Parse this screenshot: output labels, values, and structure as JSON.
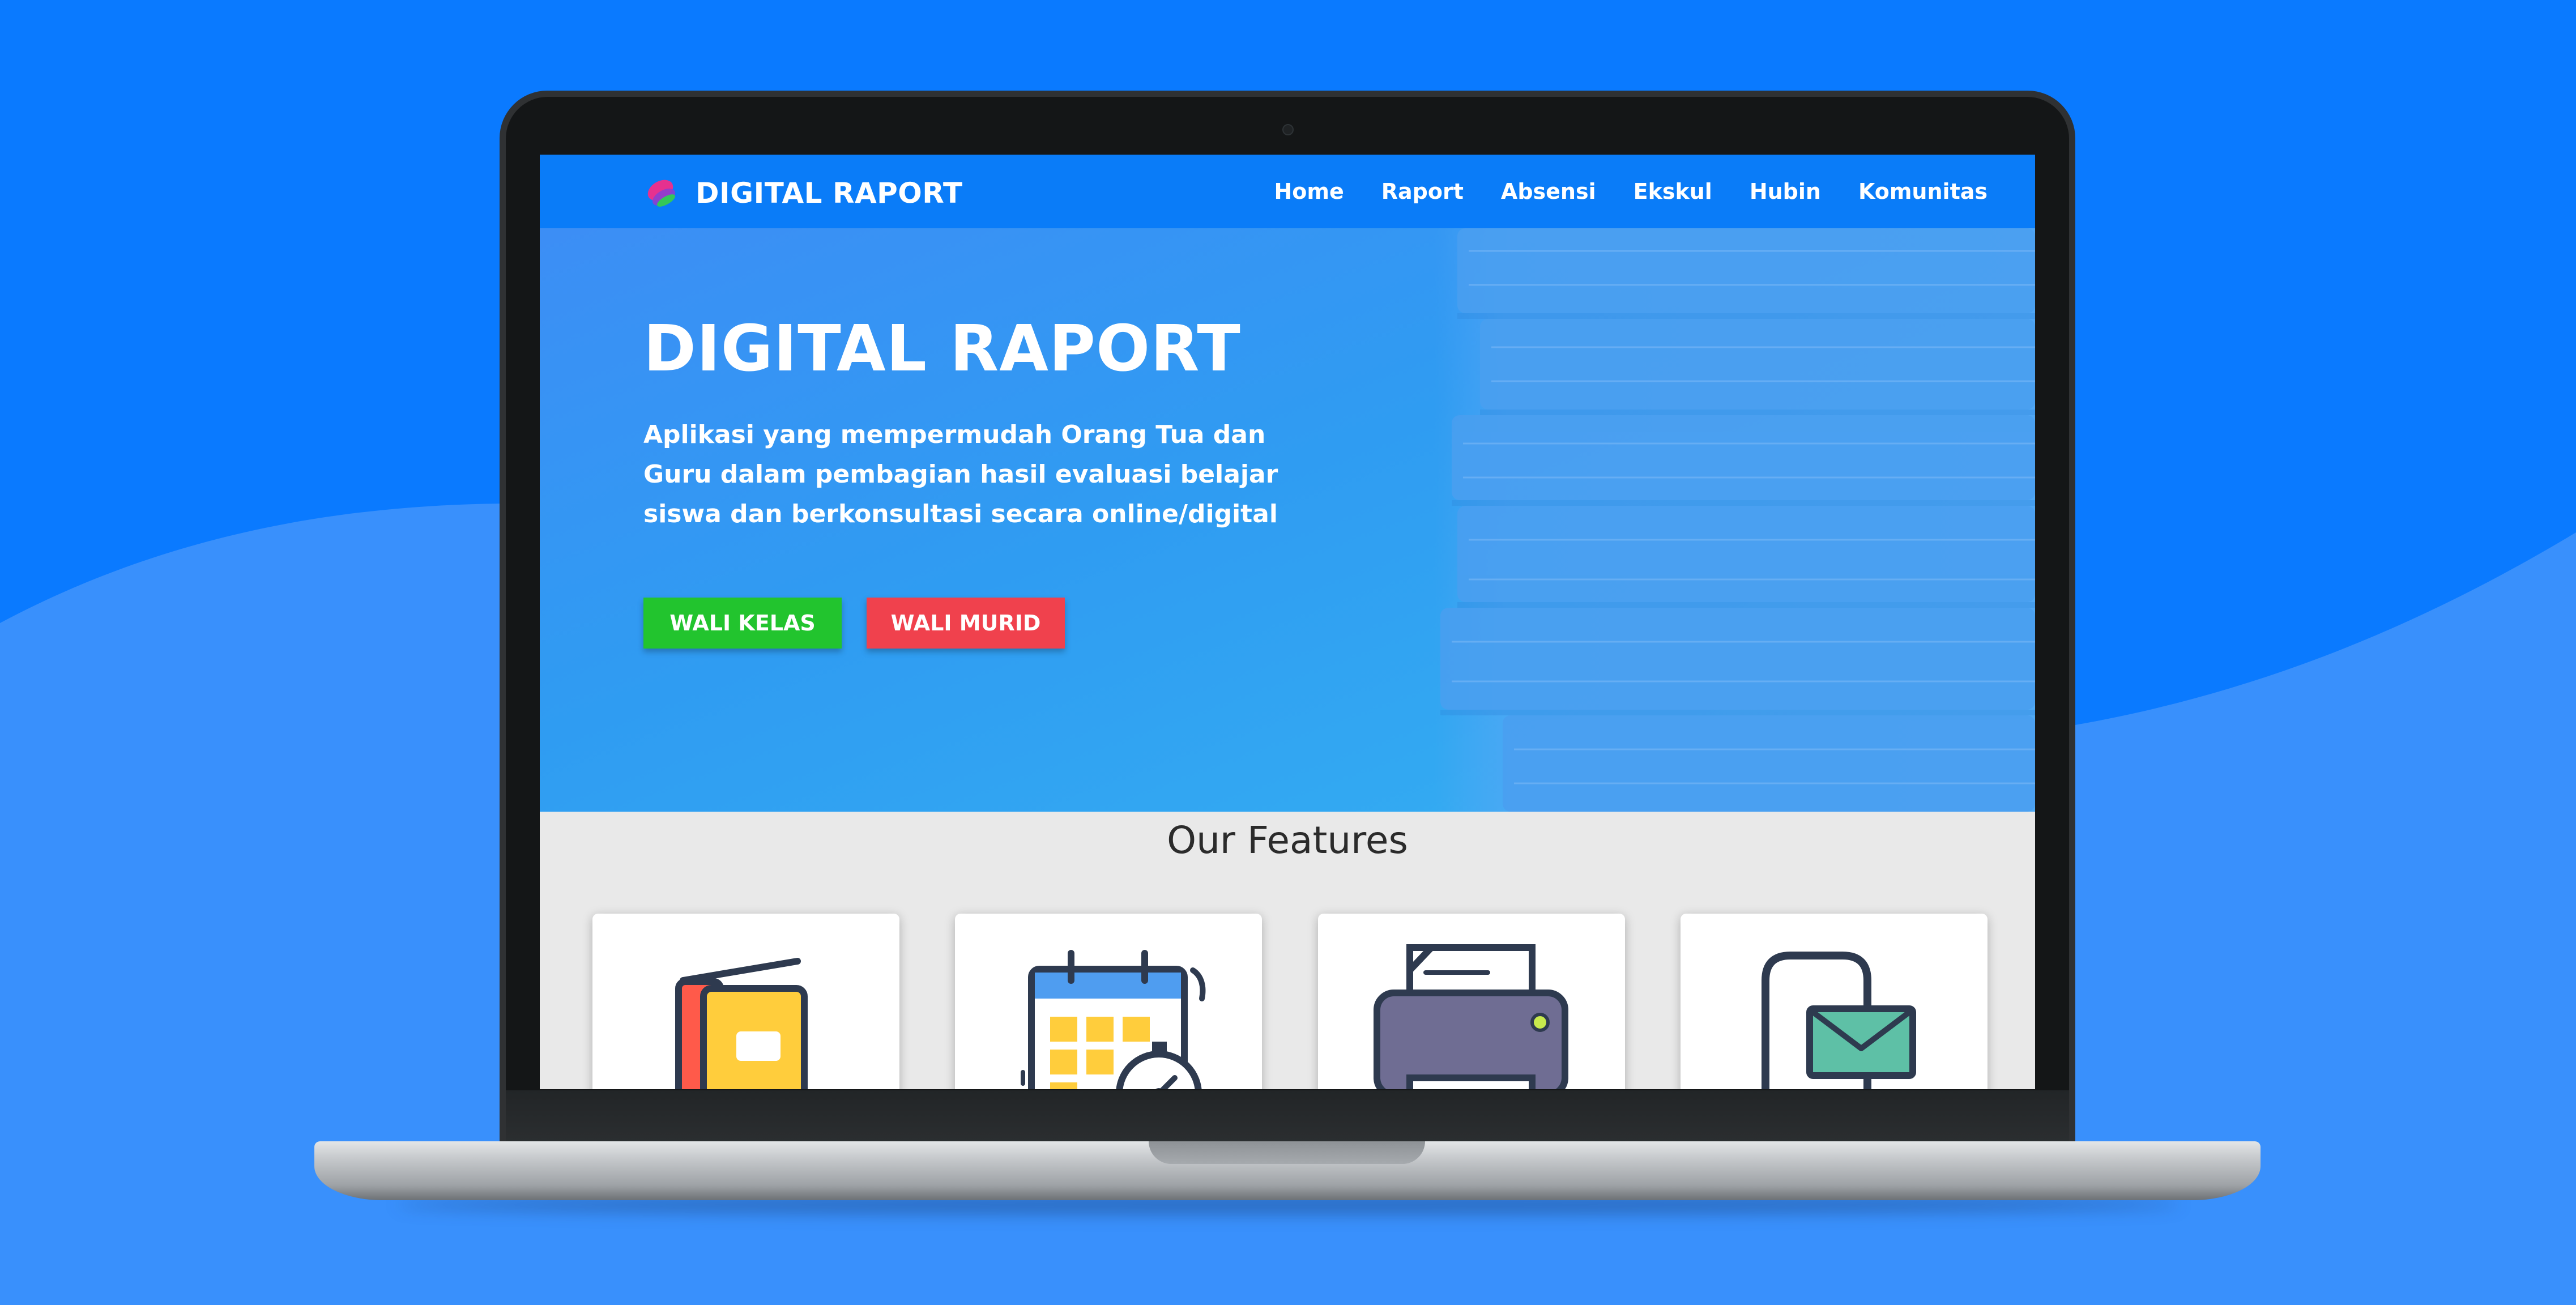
{
  "brand": {
    "name": "DIGITAL RAPORT"
  },
  "nav": {
    "items": [
      "Home",
      "Raport",
      "Absensi",
      "Ekskul",
      "Hubin",
      "Komunitas"
    ]
  },
  "hero": {
    "title": "DIGITAL RAPORT",
    "description": "Aplikasi yang mempermudah Orang Tua dan Guru dalam pembagian hasil evaluasi belajar siswa dan berkonsultasi secara online/digital",
    "buttons": {
      "wali_kelas": "WALI KELAS",
      "wali_murid": "WALI MURID"
    }
  },
  "features": {
    "title": "Our Features",
    "cards": [
      {
        "icon": "report-book-icon"
      },
      {
        "icon": "calendar-stopwatch-icon"
      },
      {
        "icon": "printer-icon"
      },
      {
        "icon": "mail-phone-icon"
      }
    ]
  },
  "colors": {
    "page_background": "#0a7aff",
    "navbar": "#0a7cf8",
    "button_green": "#22c42e",
    "button_red": "#f0414d",
    "features_background": "#e9e9e9"
  }
}
